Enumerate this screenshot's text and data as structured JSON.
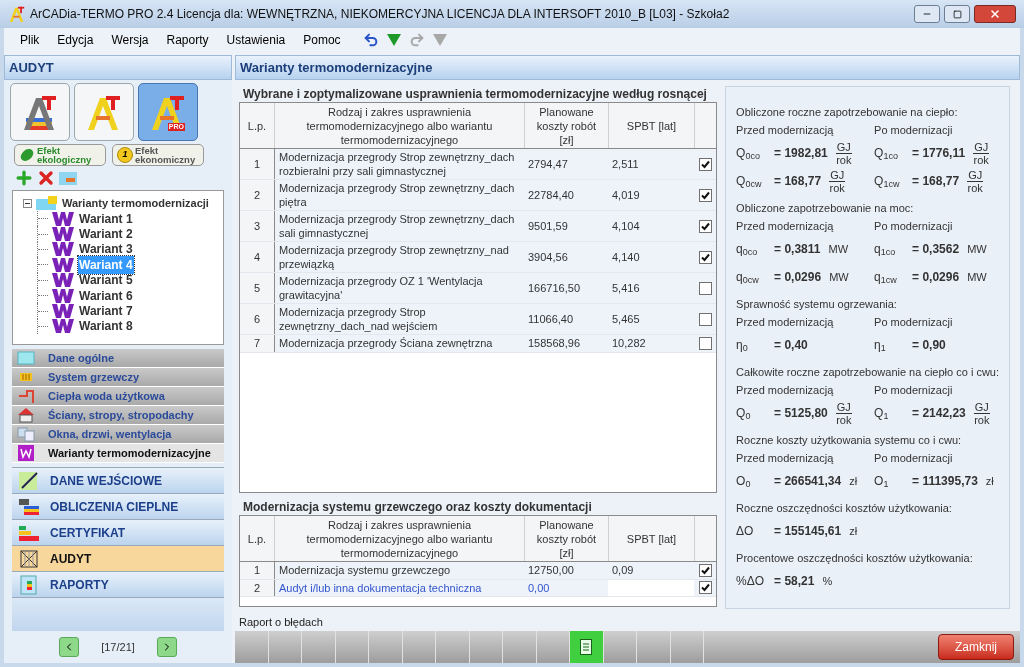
{
  "window": {
    "title": "ArCADia-TERMO PRO 2.4 Licencja dla: WEWNĘTRZNA, NIEKOMERCYJNA LICENCJA DLA INTERSOFT 2010_B [L03] - Szkoła2"
  },
  "menu": [
    "Plik",
    "Edycja",
    "Wersja",
    "Raporty",
    "Ustawienia",
    "Pomoc"
  ],
  "toolbar": [
    {
      "kind": "undo",
      "disabled": false
    },
    {
      "kind": "dropdown",
      "disabled": false
    },
    {
      "kind": "redo",
      "disabled": true
    },
    {
      "kind": "dropdown",
      "disabled": true
    }
  ],
  "sidebar": {
    "title": "AUDYT",
    "modules": [
      {
        "kind": "eco",
        "selected": false
      },
      {
        "kind": "color",
        "selected": false
      },
      {
        "kind": "pro",
        "badge": "PRO",
        "selected": true
      }
    ],
    "effects": [
      {
        "kind": "leaf",
        "label": "Efekt ekologiczny"
      },
      {
        "kind": "coin",
        "label": "Efekt ekonomiczny",
        "badge": "1"
      }
    ],
    "tree": {
      "label": "Warianty termomodernizacji",
      "expanded": true,
      "children": [
        {
          "label": "Wariant 1",
          "selected": false
        },
        {
          "label": "Wariant 2",
          "selected": false
        },
        {
          "label": "Wariant 3",
          "selected": false
        },
        {
          "label": "Wariant 4",
          "selected": true
        },
        {
          "label": "Wariant 5",
          "selected": false
        },
        {
          "label": "Wariant 6",
          "selected": false
        },
        {
          "label": "Wariant 7",
          "selected": false
        },
        {
          "label": "Wariant 8",
          "selected": false
        }
      ]
    },
    "categories": [
      {
        "kind": "general",
        "label": "Dane ogólne",
        "selected": false
      },
      {
        "kind": "heating",
        "label": "System grzewczy",
        "selected": false
      },
      {
        "kind": "water",
        "label": "Ciepła woda użytkowa",
        "selected": false
      },
      {
        "kind": "walls",
        "label": "Ściany, stropy, stropodachy",
        "selected": false
      },
      {
        "kind": "windows",
        "label": "Okna, drzwi, wentylacja",
        "selected": false
      },
      {
        "kind": "variants",
        "label": "Warianty termomodernizacyjne",
        "selected": true
      }
    ],
    "nav": [
      {
        "kind": "input",
        "label": "DANE WEJŚCIOWE",
        "selected": false
      },
      {
        "kind": "calc",
        "label": "OBLICZENIA CIEPLNE",
        "selected": false
      },
      {
        "kind": "cert",
        "label": "CERTYFIKAT",
        "selected": false
      },
      {
        "kind": "audit",
        "label": "AUDYT",
        "selected": true
      },
      {
        "kind": "report",
        "label": "RAPORTY",
        "selected": false
      }
    ],
    "pager": "[17/21]"
  },
  "main": {
    "title": "Warianty termomodernizacyjne",
    "table1": {
      "title": "Wybrane i zoptymalizowane usprawnienia termomodernizacyjne według rosnącej",
      "columns": [
        "L.p.",
        "Rodzaj i zakres usprawnienia termomodernizacyjnego albo wariantu termomodernizacyjnego",
        "Planowane koszty robót [zł]",
        "SPBT [lat]"
      ],
      "rows": [
        {
          "lp": "1",
          "name": "Modernizacja przegrody Strop zewnętrzny_dach rozbieralni przy sali gimnastycznej",
          "cost": "2794,47",
          "spbt": "2,511",
          "checked": true
        },
        {
          "lp": "2",
          "name": "Modernizacja przegrody Strop zewnętrzny_dach piętra",
          "cost": "22784,40",
          "spbt": "4,019",
          "checked": true
        },
        {
          "lp": "3",
          "name": "Modernizacja przegrody Strop zewnętrzny_dach sali gimnastycznej",
          "cost": "9501,59",
          "spbt": "4,104",
          "checked": true
        },
        {
          "lp": "4",
          "name": "Modernizacja przegrody Strop zewnętrzny_nad przewiązką",
          "cost": "3904,56",
          "spbt": "4,140",
          "checked": true
        },
        {
          "lp": "5",
          "name": "Modernizacja przegrody OZ 1 'Wentylacja grawitacyjna'",
          "cost": "166716,50",
          "spbt": "5,416",
          "checked": false
        },
        {
          "lp": "6",
          "name": "Modernizacja przegrody Strop zewnętrzny_dach_nad wejściem",
          "cost": "11066,40",
          "spbt": "5,465",
          "checked": false
        },
        {
          "lp": "7",
          "name": "Modernizacja przegrody Ściana zewnętrzna",
          "cost": "158568,96",
          "spbt": "10,282",
          "checked": false
        }
      ]
    },
    "table2": {
      "title": "Modernizacja systemu grzewczego oraz koszty dokumentacji",
      "columns": [
        "L.p.",
        "Rodzaj i zakres usprawnienia termomodernizacyjnego albo wariantu termomodernizacyjnego",
        "Planowane koszty robót [zł]",
        "SPBT [lat]"
      ],
      "rows": [
        {
          "kind": "computed",
          "lp": "1",
          "name": "Modernizacja systemu grzewczego",
          "cost": "12750,00",
          "spbt": "0,09",
          "checked": true
        },
        {
          "kind": "editable",
          "lp": "2",
          "name": "Audyt i/lub inna dokumentacja techniczna",
          "cost": "0,00",
          "checked": true
        }
      ]
    },
    "errors_label": "Raport o błędach",
    "close_button": "Zamknij"
  },
  "results": [
    {
      "heading": "Obliczone roczne zapotrzebowanie na ciepło:",
      "before": "Przed modernizacją",
      "after": "Po modernizacji",
      "rows": [
        [
          {
            "symbol": "Q$_{0co}$",
            "value": "= 1982,81",
            "unit": {
              "kind": "fraction",
              "top": "GJ",
              "bottom": "rok"
            }
          },
          {
            "symbol": "Q$_{1co}$",
            "value": "= 1776,11",
            "unit": {
              "kind": "fraction",
              "top": "GJ",
              "bottom": "rok"
            }
          }
        ],
        [
          {
            "symbol": "Q$_{0cw}$",
            "value": "= 168,77",
            "unit": {
              "kind": "fraction",
              "top": "GJ",
              "bottom": "rok"
            }
          },
          {
            "symbol": "Q$_{1cw}$",
            "value": "= 168,77",
            "unit": {
              "kind": "fraction",
              "top": "GJ",
              "bottom": "rok"
            }
          }
        ]
      ]
    },
    {
      "heading": "Obliczone zapotrzebowanie na moc:",
      "before": "Przed modernizacją",
      "after": "Po modernizacji",
      "rows": [
        [
          {
            "symbol": "q$_{0co}$",
            "value": "= 0,3811",
            "unit": {
              "kind": "text",
              "text": "MW"
            }
          },
          {
            "symbol": "q$_{1co}$",
            "value": "= 0,3562",
            "unit": {
              "kind": "text",
              "text": "MW"
            }
          }
        ],
        [
          {
            "symbol": "q$_{0cw}$",
            "value": "= 0,0296",
            "unit": {
              "kind": "text",
              "text": "MW"
            }
          },
          {
            "symbol": "q$_{1cw}$",
            "value": "= 0,0296",
            "unit": {
              "kind": "text",
              "text": "MW"
            }
          }
        ]
      ]
    },
    {
      "heading": "Sprawność systemu ogrzewania:",
      "before": "Przed modernizacją",
      "after": "Po modernizacji",
      "rows": [
        [
          {
            "symbol": "η$_{0}$",
            "value": "= 0,40"
          },
          {
            "symbol": "η$_{1}$",
            "value": "= 0,90"
          }
        ]
      ]
    },
    {
      "heading": "Całkowite roczne zapotrzebowanie na ciepło co i cwu:",
      "before": "Przed modernizacją",
      "after": "Po modernizacji",
      "rows": [
        [
          {
            "symbol": "Q$_{0}$",
            "value": "= 5125,80",
            "unit": {
              "kind": "fraction",
              "top": "GJ",
              "bottom": "rok"
            }
          },
          {
            "symbol": "Q$_{1}$",
            "value": "= 2142,23",
            "unit": {
              "kind": "fraction",
              "top": "GJ",
              "bottom": "rok"
            }
          }
        ]
      ]
    },
    {
      "heading": "Roczne koszty użytkowania systemu co i cwu:",
      "before": "Przed modernizacją",
      "after": "Po modernizacji",
      "rows": [
        [
          {
            "symbol": "O$_{0}$",
            "value": "= 266541,34",
            "unit": {
              "kind": "text",
              "text": "zł"
            }
          },
          {
            "symbol": "O$_{1}$",
            "value": "= 111395,73",
            "unit": {
              "kind": "text",
              "text": "zł"
            }
          }
        ]
      ]
    },
    {
      "heading": "Roczne oszczędności kosztów użytkowania:",
      "rows": [
        [
          {
            "symbol": "ΔO",
            "value": "= 155145,61",
            "unit": {
              "kind": "text",
              "text": "zł"
            }
          }
        ]
      ]
    },
    {
      "heading": "Procentowe oszczędności kosztów użytkowania:",
      "rows": [
        [
          {
            "symbol": "%ΔO",
            "value": "= 58,21",
            "unit": {
              "kind": "text",
              "text": "%"
            }
          }
        ]
      ]
    }
  ]
}
